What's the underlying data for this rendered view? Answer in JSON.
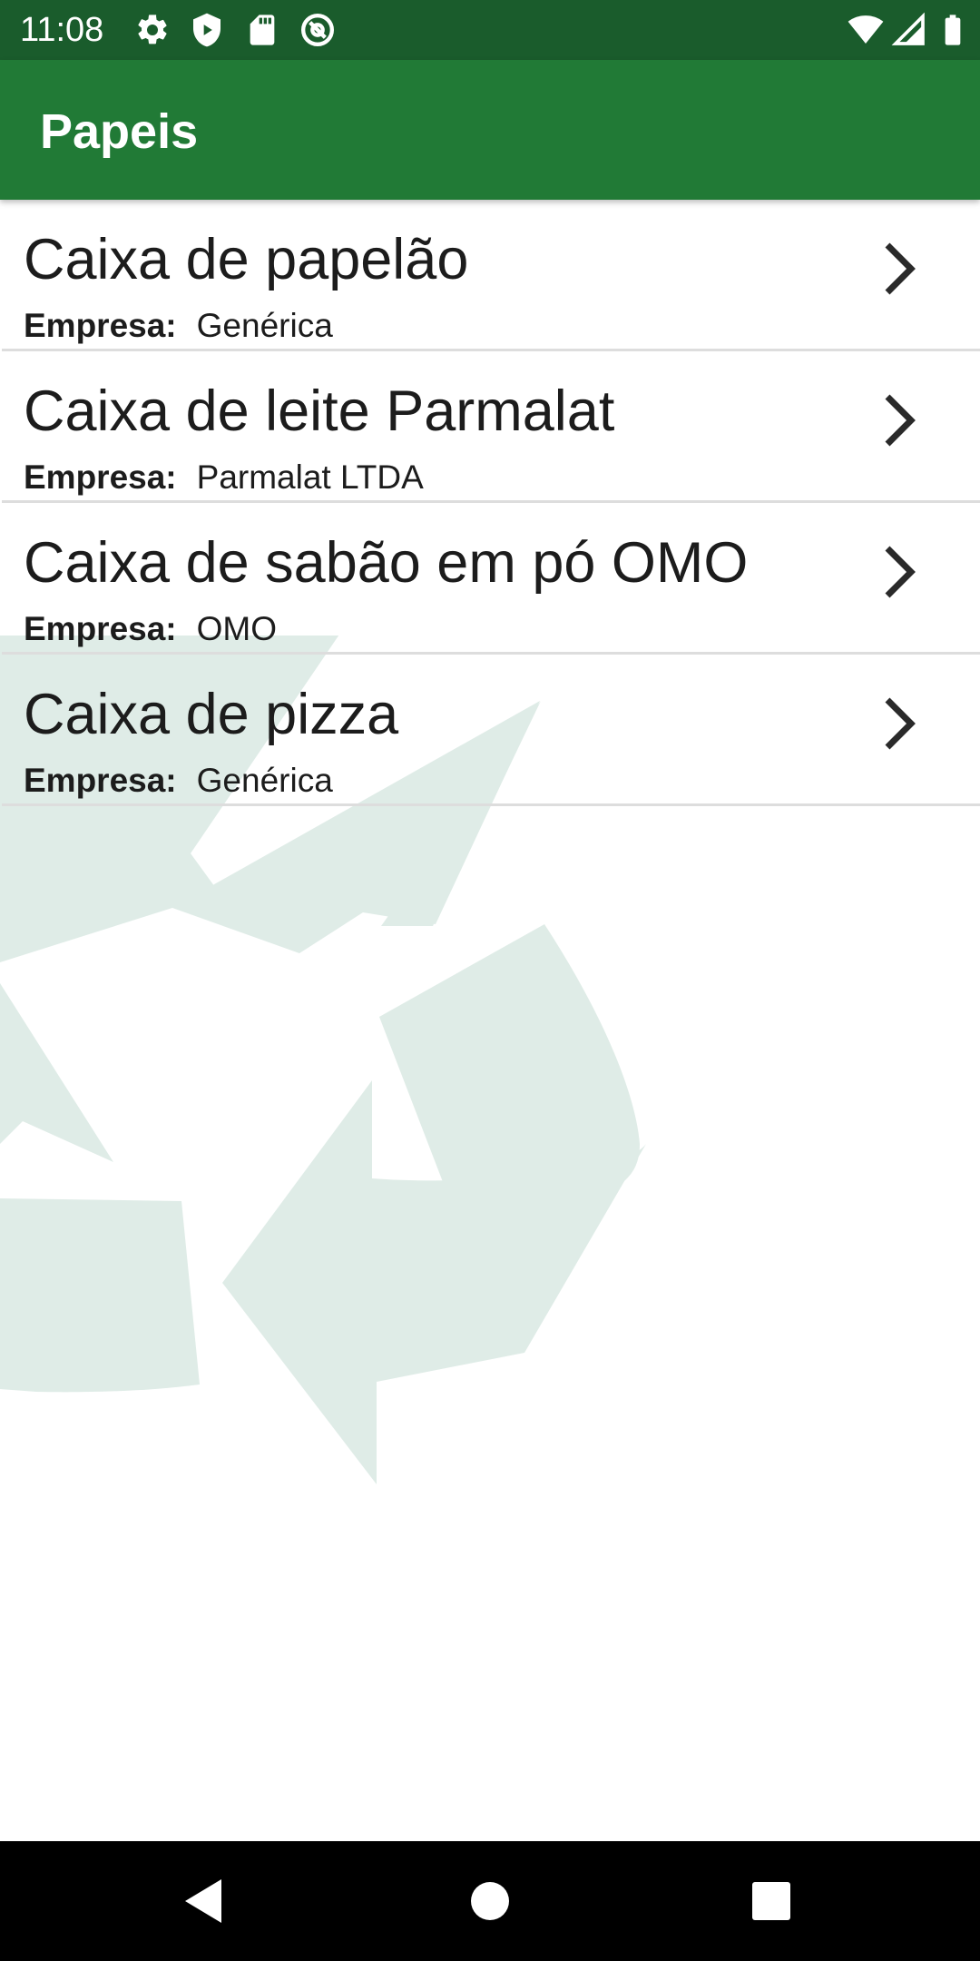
{
  "status_bar": {
    "time": "11:08",
    "left_icons": [
      "settings-icon",
      "shield-icon",
      "sd-card-icon",
      "at-sign-icon"
    ],
    "right_icons": [
      "wifi-icon",
      "cell-signal-icon",
      "battery-icon"
    ]
  },
  "app_bar": {
    "title": "Papeis"
  },
  "list": {
    "company_label": "Empresa:",
    "items": [
      {
        "title": "Caixa de papelão",
        "company": "Genérica"
      },
      {
        "title": "Caixa de leite Parmalat",
        "company": "Parmalat LTDA"
      },
      {
        "title": "Caixa de sabão em pó OMO",
        "company": "OMO"
      },
      {
        "title": "Caixa de pizza",
        "company": "Genérica"
      }
    ]
  },
  "watermark": {
    "icon": "recycle-icon",
    "color": "#dfece7"
  },
  "nav_bar": {
    "buttons": [
      "back-icon",
      "home-icon",
      "recents-icon"
    ]
  },
  "colors": {
    "status_bar": "#1a5c2c",
    "app_bar": "#217a36",
    "divider": "#dddddd",
    "text": "#1c1c1c"
  }
}
